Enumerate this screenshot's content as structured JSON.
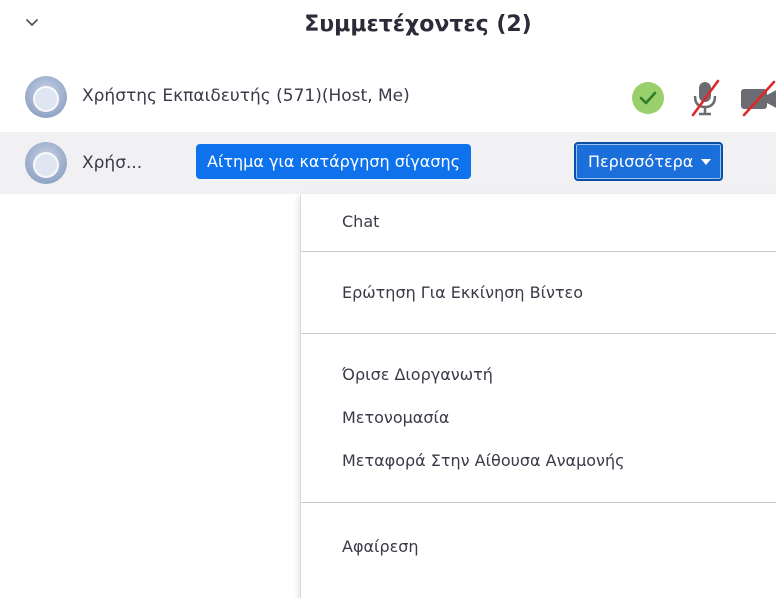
{
  "header": {
    "title": "Συμμετέχοντες (2)"
  },
  "participants": [
    {
      "name": "Χρήστης Εκπαιδευτής (571)(Host, Me)"
    },
    {
      "name": "Χρήσ...",
      "unmute_request_label": "Αίτημα για κατάργηση σίγασης",
      "more_label": "Περισσότερα"
    }
  ],
  "menu": {
    "groups": [
      [
        "Chat"
      ],
      [
        "Ερώτηση Για Εκκίνηση Βίντεο"
      ],
      [
        "Όρισε Διοργανωτή",
        "Μετονομασία",
        "Μεταφορά Στην Αίθουσα Αναμονής"
      ],
      [
        "Αφαίρεση"
      ]
    ]
  },
  "colors": {
    "primary_button": "#0e72ed",
    "more_button": "#1a6fdb",
    "check_green": "#7ac94a",
    "muted_red": "#e02828",
    "row_highlight": "#f1f1f4"
  },
  "icons": {
    "collapse": "chevron-down-icon",
    "avatar": "avatar-icon",
    "status": "check-icon",
    "mic": "mic-muted-icon",
    "video": "video-off-icon"
  }
}
